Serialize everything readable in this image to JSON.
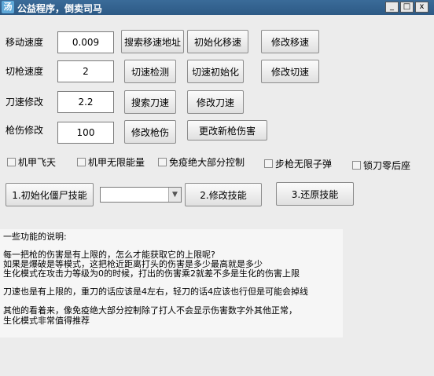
{
  "window": {
    "title": "公益程序，倒卖司马",
    "app_icon": "汤",
    "controls": {
      "minimize": "_",
      "maximize": "□",
      "close": "x"
    }
  },
  "rows": [
    {
      "label": "移动速度",
      "value": "0.009",
      "buttons": [
        "搜索移速地址",
        "初始化移速",
        "修改移速"
      ]
    },
    {
      "label": "切枪速度",
      "value": "2",
      "buttons": [
        "切速检测",
        "切速初始化",
        "修改切速"
      ]
    },
    {
      "label": "刀速修改",
      "value": "2.2",
      "buttons": [
        "搜索刀速",
        "修改刀速"
      ]
    },
    {
      "label": "枪伤修改",
      "value": "100",
      "buttons": [
        "修改枪伤",
        "更改新枪伤害"
      ]
    }
  ],
  "checkboxes": [
    "机甲飞天",
    "机甲无限能量",
    "免疫绝大部分控制",
    "步枪无限子弹",
    "锁刀零后座"
  ],
  "zombie": {
    "init_button": "1.初始化僵尸技能",
    "select_value": "",
    "modify_button": "2.修改技能",
    "restore_button": "3.还原技能"
  },
  "info": {
    "heading": "一些功能的说明:",
    "lines": [
      "每一把枪的伤害是有上限的，怎么才能获取它的上限呢?",
      "如果是爆破是等模式，这把枪近距离打头的伤害是多少最高就是多少",
      "生化模式在攻击力等级为0的时候，打出的伤害乘2就差不多是生化的伤害上限",
      "刀速也是有上限的，重刀的话应该是4左右，轻刀的话4应该也行但是可能会掉线",
      "其他的看着来，像免疫绝大部分控制除了打人不会显示伤害数字外其他正常，",
      "生化模式非常值得推荐"
    ]
  }
}
